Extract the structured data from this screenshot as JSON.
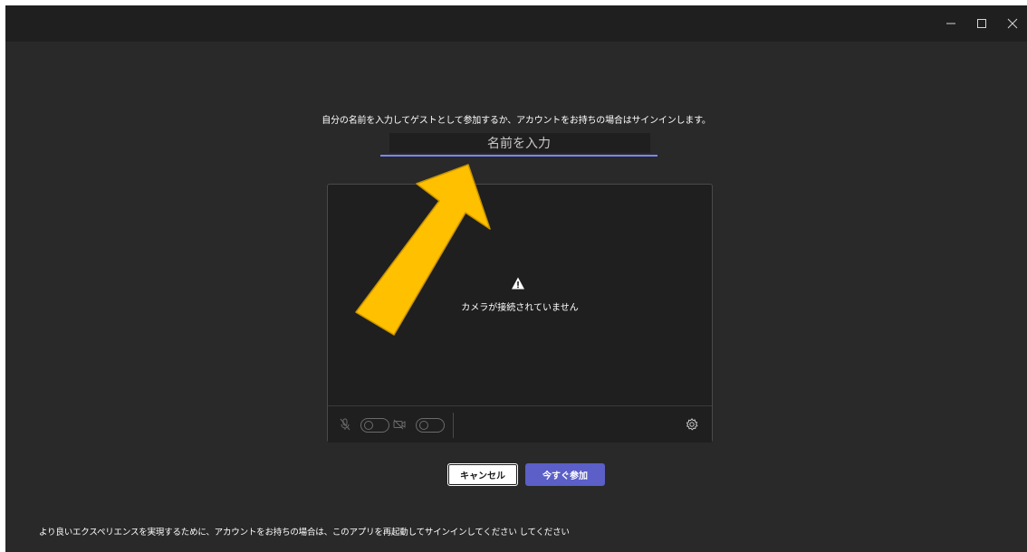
{
  "window": {
    "minimize_icon": "minimize-icon",
    "maximize_icon": "maximize-icon",
    "close_icon": "close-icon"
  },
  "join": {
    "prompt": "自分の名前を入力してゲストとして参加するか、アカウントをお持ちの場合はサインインします。",
    "name_input": {
      "value": "",
      "placeholder": "名前を入力"
    }
  },
  "preview": {
    "warning_icon": "warning-icon",
    "camera_message": "カメラが接続されていません",
    "controls": {
      "mic_icon": "mic-off-icon",
      "mic_toggle": "off",
      "camera_icon": "camera-off-icon",
      "camera_toggle": "off",
      "settings_icon": "gear-icon"
    }
  },
  "actions": {
    "cancel_label": "キャンセル",
    "join_label": "今すぐ参加"
  },
  "footer": {
    "text": "より良いエクスペリエンスを実現するために、アカウントをお持ちの場合は、このアプリを再起動してサインインしてください してください"
  },
  "colors": {
    "background": "#292929",
    "titlebar": "#1f1f1f",
    "accent": "#5b5fc7",
    "underline": "#7f85f5",
    "annotation_arrow": "#ffc000"
  }
}
